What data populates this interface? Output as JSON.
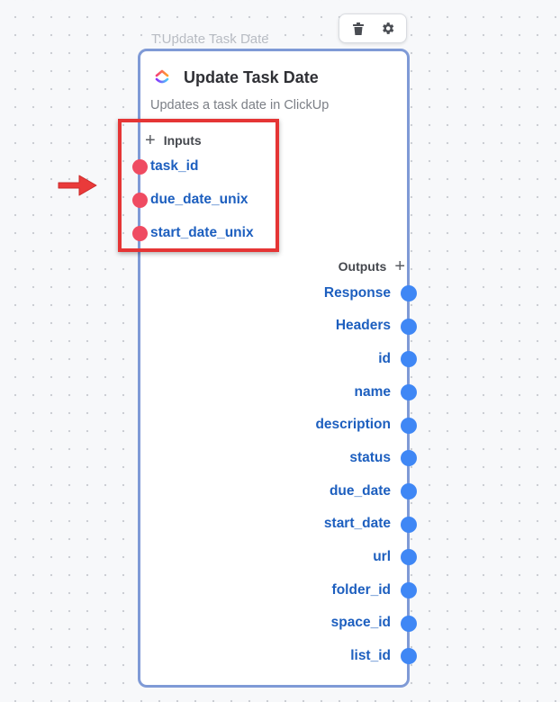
{
  "node": {
    "label": "T:Update Task Date",
    "title": "Update Task Date",
    "description": "Updates a task date in ClickUp",
    "logo_icon": "clickup-logo-icon"
  },
  "toolbar": {
    "delete_icon": "trash-icon",
    "settings_icon": "gear-icon"
  },
  "inputs": {
    "heading": "Inputs",
    "add_icon": "plus-icon",
    "items": [
      "task_id",
      "due_date_unix",
      "start_date_unix"
    ]
  },
  "outputs": {
    "heading": "Outputs",
    "add_icon": "plus-icon",
    "items": [
      "Response",
      "Headers",
      "id",
      "name",
      "description",
      "status",
      "due_date",
      "start_date",
      "url",
      "folder_id",
      "space_id",
      "list_id"
    ]
  },
  "colors": {
    "input_port": "#ef4b61",
    "output_port": "#3f87f5",
    "port_label": "#1d5fbf",
    "node_border": "#7f9ad6",
    "annotation": "#e53535"
  }
}
